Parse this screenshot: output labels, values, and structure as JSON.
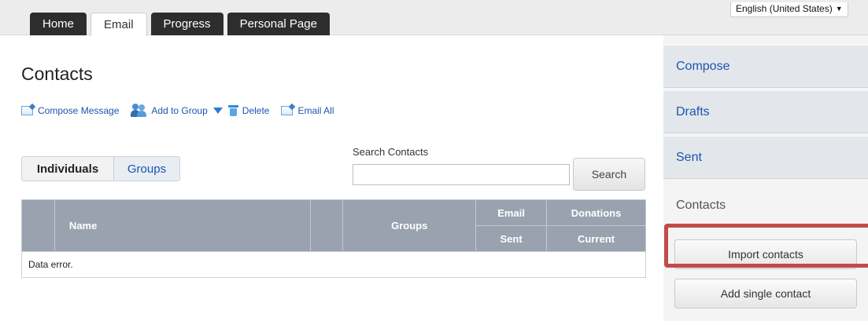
{
  "tabs": [
    "Home",
    "Email",
    "Progress",
    "Personal Page"
  ],
  "active_tab": "Email",
  "language": {
    "label": "English (United States)"
  },
  "page_title": "Contacts",
  "actions": {
    "compose": "Compose Message",
    "add_group": "Add to Group",
    "delete": "Delete",
    "email_all": "Email All"
  },
  "segment": {
    "individuals": "Individuals",
    "groups": "Groups"
  },
  "search": {
    "label": "Search Contacts",
    "value": "",
    "button": "Search"
  },
  "table": {
    "headers": {
      "name": "Name",
      "groups": "Groups",
      "email": "Email",
      "sent": "Sent",
      "donations": "Donations",
      "current": "Current"
    },
    "message": "Data error."
  },
  "sidebar": {
    "nav": [
      "Compose",
      "Drafts",
      "Sent"
    ],
    "heading": "Contacts",
    "import_button": "Import contacts",
    "add_button": "Add single contact"
  },
  "colors": {
    "highlight": "#c24a4a",
    "link": "#1a55b0",
    "table_header": "#9aa2b0"
  }
}
